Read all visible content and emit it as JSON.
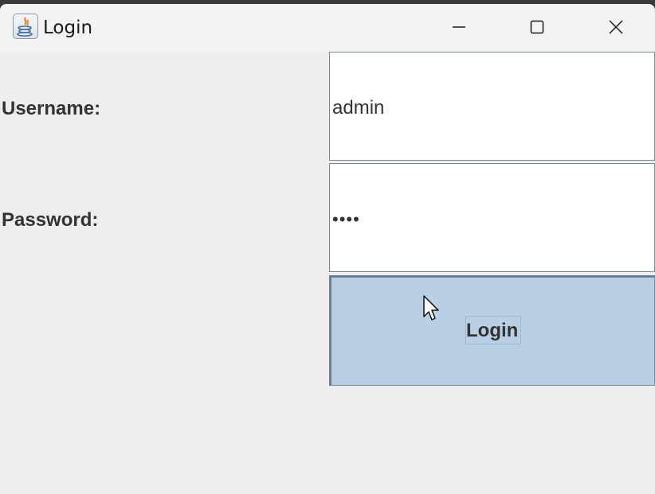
{
  "window": {
    "title": "Login",
    "icon": "java-icon",
    "controls": [
      "minimize-icon",
      "maximize-icon",
      "close-icon"
    ]
  },
  "form": {
    "username_label": "Username:",
    "username_value": "admin",
    "password_label": "Password:",
    "password_value": "••••",
    "login_button_label": "Login"
  },
  "colors": {
    "button_background": "#b8cfe5",
    "field_border": "#7a8a99",
    "label_text": "#333333"
  }
}
